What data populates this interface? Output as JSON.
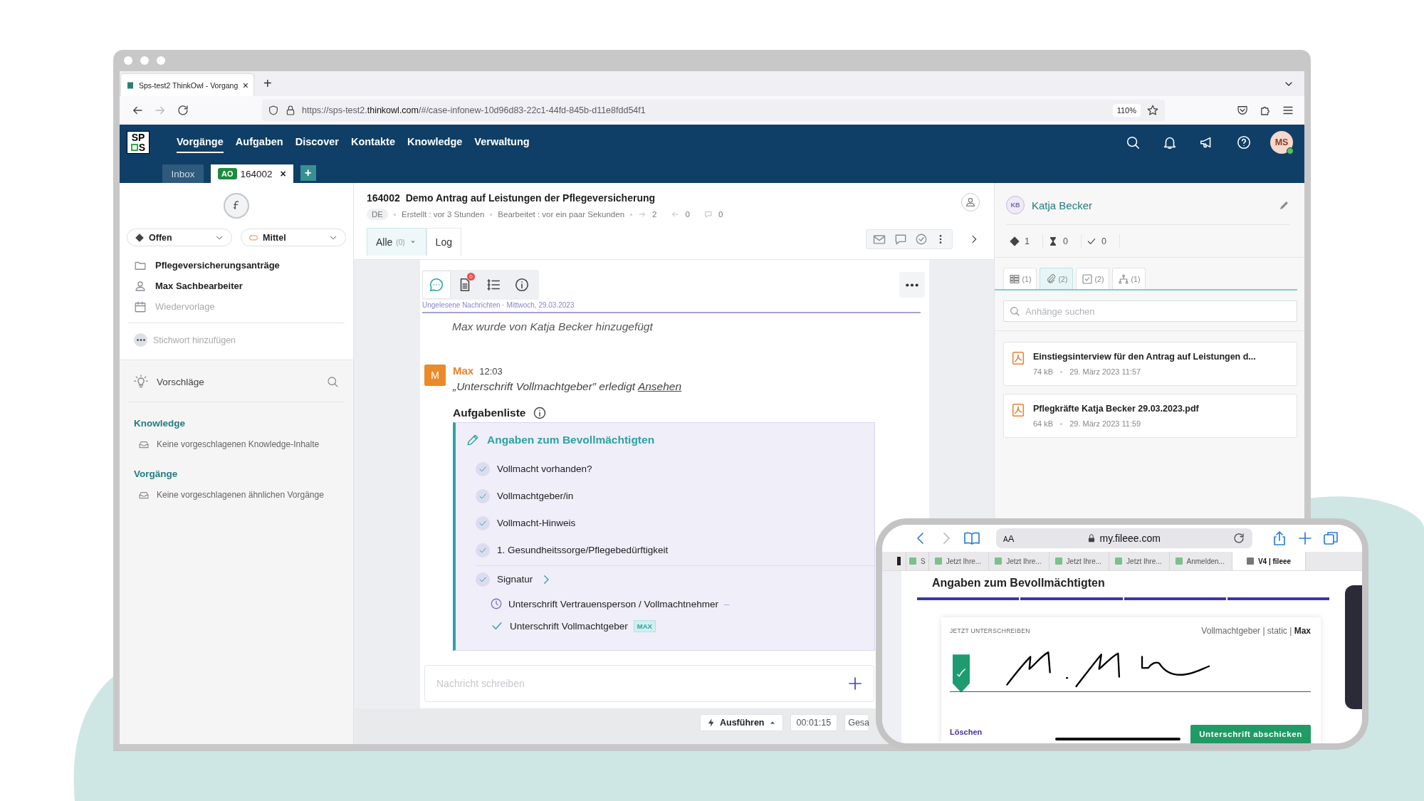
{
  "browser": {
    "tab": {
      "title": "Sps-test2 ThinkOwl - Vorgang",
      "close": "×",
      "selected": true
    },
    "new_tab": "+",
    "url": "https://sps-test2.**thinkowl.com**/#/case-infonew-10d96d83-22c1-44fd-845b-d11e8fdd54f1",
    "zoom": "110%"
  },
  "app_nav": {
    "logo": [
      "SP",
      "S"
    ],
    "items": [
      {
        "label": "Vorgänge",
        "selected": true
      },
      {
        "label": "Aufgaben",
        "selected": false
      },
      {
        "label": "Discover",
        "selected": false
      },
      {
        "label": "Kontakte",
        "selected": false
      },
      {
        "label": "Knowledge",
        "selected": false
      },
      {
        "label": "Verwaltung",
        "selected": false
      }
    ],
    "user": {
      "initials": "MS",
      "online": true
    }
  },
  "case_tabs": {
    "items": [
      {
        "kind": "inbox",
        "label": "Inbox",
        "selected": false
      },
      {
        "kind": "case",
        "badge": "AO",
        "label": "164002",
        "close": "×",
        "selected": true
      }
    ],
    "add": "+"
  },
  "sidebar": {
    "dropdowns": [
      {
        "kind": "status",
        "label": "Offen"
      },
      {
        "kind": "priority",
        "label": "Mittel"
      }
    ],
    "details": [
      {
        "kind": "folder",
        "text": "Pflegeversicherungsanträge",
        "filled": true
      },
      {
        "kind": "user",
        "text": "Max Sachbearbeiter",
        "filled": true
      },
      {
        "kind": "calendar",
        "text": "Wiedervorlage",
        "filled": false
      }
    ],
    "tag_placeholder": "Stichwort hinzufügen",
    "suggestions": {
      "title": "Vorschläge",
      "sections": [
        {
          "title": "Knowledge",
          "empty_text": "Keine vorgeschlagenen Knowledge-Inhalte"
        },
        {
          "title": "Vorgänge",
          "empty_text": "Keine vorgeschlagenen ähnlichen Vorgänge"
        }
      ]
    }
  },
  "case": {
    "id": "164002",
    "title": "Demo Antrag auf Leistungen der Pflegeversicherung",
    "language": "DE",
    "created": "Erstellt : vor 3 Stunden",
    "edited": "Bearbeitet : vor ein paar Sekunden",
    "counters": [
      {
        "kind": "outgoing",
        "value": "2"
      },
      {
        "kind": "incoming",
        "value": "0"
      },
      {
        "kind": "comments",
        "value": "0"
      }
    ],
    "tabs": [
      {
        "label": "Alle",
        "count": "(0)",
        "selected": true
      },
      {
        "label": "Log",
        "selected": false
      }
    ]
  },
  "conversation": {
    "tools": [
      {
        "kind": "chat",
        "selected": true
      },
      {
        "kind": "document",
        "badge": "0",
        "selected": false
      },
      {
        "kind": "list",
        "selected": false
      },
      {
        "kind": "info",
        "selected": false
      }
    ],
    "divider": "Ungelesene Nachrichten · Mittwoch, 29.03.2023",
    "system_message": "Max wurde von Katja Becker hinzugefügt",
    "message": {
      "avatar": "M",
      "author": "Max",
      "time": "12:03",
      "text": "„Unterschrift Vollmachtgeber” erledigt",
      "link": "Ansehen"
    },
    "task_list": {
      "title": "Aufgabenliste",
      "group": "Angaben zum Bevollmächtigten",
      "items": [
        {
          "label": "Vollmacht vorhanden?",
          "done": true
        },
        {
          "label": "Vollmachtgeber/in",
          "done": true
        },
        {
          "label": "Vollmacht-Hinweis",
          "done": true
        },
        {
          "label": "1. Gesundheitssorge/Pflegebedürftigkeit",
          "done": true
        },
        {
          "label": "Signatur",
          "done": true,
          "children": [
            {
              "label": "Unterschrift Vertrauensperson / Vollmachtnehmer",
              "done": false,
              "trail": "–"
            },
            {
              "label": "Unterschrift Vollmachtgeber",
              "done": true,
              "tag": "MAX"
            }
          ]
        }
      ]
    },
    "composer": {
      "placeholder": "Nachricht schreiben"
    }
  },
  "footer": {
    "action": "Ausführen",
    "timer": "00:01:15",
    "total": "Gesa"
  },
  "contact": {
    "initials": "KB",
    "name": "Katja Becker",
    "stats": [
      {
        "kind": "ticket",
        "value": "1"
      },
      {
        "kind": "waiting",
        "value": "0"
      },
      {
        "kind": "done",
        "value": "0"
      }
    ],
    "tabs": [
      {
        "kind": "fields",
        "count": "(1)",
        "selected": false
      },
      {
        "kind": "attachments",
        "count": "(2)",
        "selected": true
      },
      {
        "kind": "tasks",
        "count": "(2)",
        "selected": false
      },
      {
        "kind": "relations",
        "count": "(1)",
        "selected": false
      }
    ],
    "search": {
      "placeholder": "Anhänge suchen"
    },
    "attachments": [
      {
        "name": "Einstiegsinterview für den Antrag auf Leistungen d...",
        "size": "74 kB",
        "date": "29. März 2023 11:57"
      },
      {
        "name": "Pflegkräfte Katja Becker 29.03.2023.pdf",
        "size": "64 kB",
        "date": "29. März 2023 11:59"
      }
    ]
  },
  "phone": {
    "text_size": "AA",
    "address": "my.fileee.com",
    "tabs": [
      {
        "label": "S",
        "selected": false
      },
      {
        "label": "Jetzt Ihre...",
        "selected": false
      },
      {
        "label": "Jetzt Ihre...",
        "selected": false
      },
      {
        "label": "Jetzt Ihre...",
        "selected": false
      },
      {
        "label": "Jetzt Ihre...",
        "selected": false
      },
      {
        "label": "Anmelden...",
        "selected": false
      },
      {
        "label": "V4 | fileee",
        "selected": true
      }
    ],
    "page_title": "Angaben zum Bevollmächtigten",
    "sign_label": "JETZT UNTERSCHREIBEN",
    "signer": "Vollmachtgeber | static | **Max**",
    "clear": "Löschen",
    "submit": "Unterschrift abschicken"
  }
}
